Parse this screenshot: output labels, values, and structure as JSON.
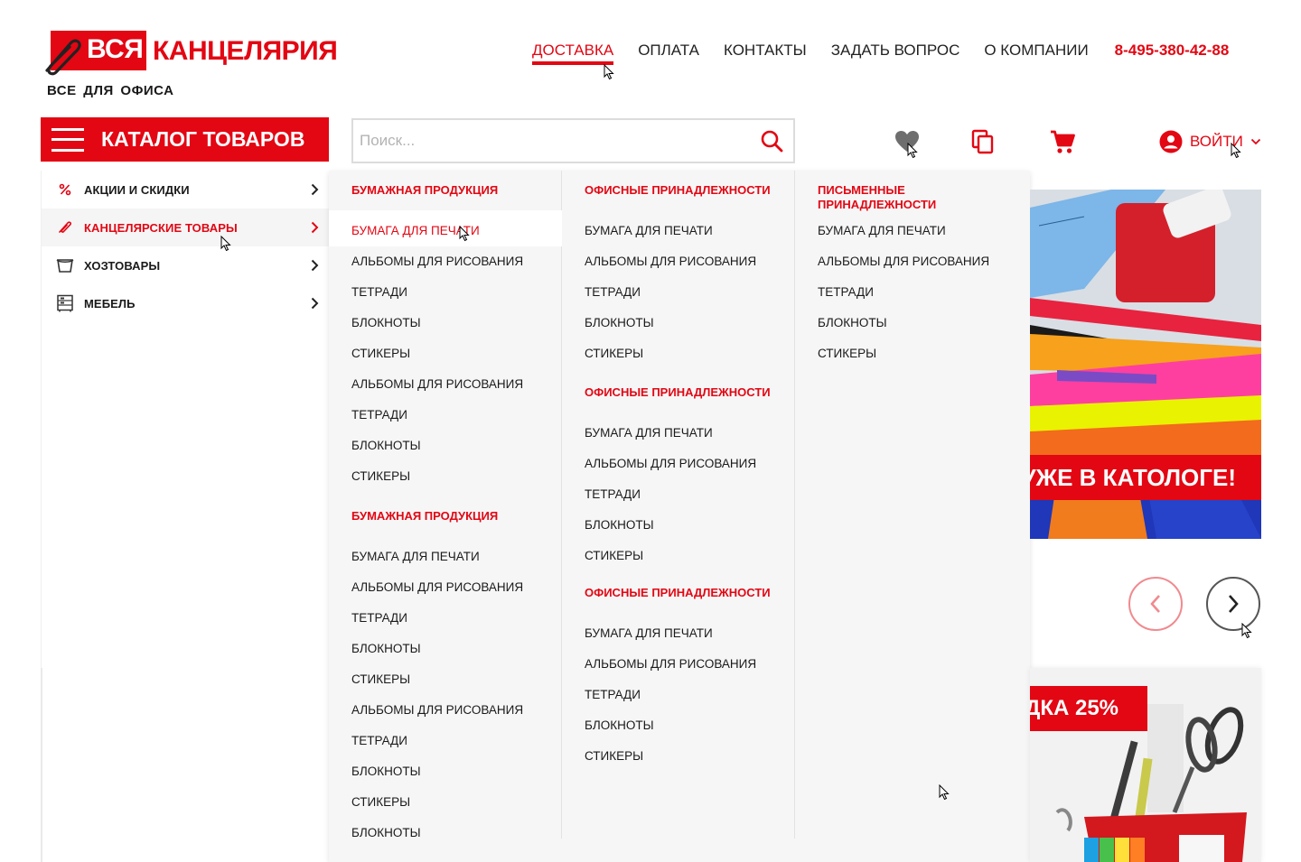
{
  "logo": {
    "badge": "ВСЯ",
    "name": "КАНЦЕЛЯРИЯ",
    "tagline": "ВСЕ ДЛЯ ОФИСА"
  },
  "topnav": {
    "items": [
      "ДОСТАВКА",
      "ОПЛАТА",
      "КОНТАКТЫ",
      "ЗАДАТЬ ВОПРОС",
      "О КОМПАНИИ"
    ],
    "active": "ДОСТАВКА",
    "phone": "8-495-380-42-88"
  },
  "catalog": {
    "label": "КАТАЛОГ ТОВАРОВ"
  },
  "search": {
    "placeholder": "Поиск...",
    "value": ""
  },
  "header_icons": [
    "heart-icon",
    "compare-icon",
    "cart-icon"
  ],
  "login": {
    "label": "ВОЙТИ"
  },
  "colors": {
    "accent": "#e30613",
    "menu_bg": "#f6f6f6",
    "text": "#1a1a1a"
  },
  "sidebar": {
    "items": [
      {
        "label": "АКЦИИ И СКИДКИ",
        "icon": "percent-icon",
        "active": false
      },
      {
        "label": "КАНЦЕЛЯРСКИЕ ТОВАРЫ",
        "icon": "paperclip-icon",
        "active": true
      },
      {
        "label": "ХОЗТОВАРЫ",
        "icon": "bucket-icon",
        "active": false
      },
      {
        "label": "МЕБЕЛЬ",
        "icon": "cabinet-icon",
        "active": false
      }
    ]
  },
  "mega": {
    "col1": {
      "head1": "БУМАЖНАЯ ПРОДУКЦИЯ",
      "links1": [
        "БУМАГА ДЛЯ ПЕЧАТИ",
        "АЛЬБОМЫ ДЛЯ РИСОВАНИЯ",
        "ТЕТРАДИ",
        "БЛОКНОТЫ",
        "СТИКЕРЫ",
        "АЛЬБОМЫ ДЛЯ РИСОВАНИЯ",
        "ТЕТРАДИ",
        "БЛОКНОТЫ",
        "СТИКЕРЫ"
      ],
      "head2": "БУМАЖНАЯ ПРОДУКЦИЯ",
      "links2": [
        "БУМАГА ДЛЯ ПЕЧАТИ",
        "АЛЬБОМЫ ДЛЯ РИСОВАНИЯ",
        "ТЕТРАДИ",
        "БЛОКНОТЫ",
        "СТИКЕРЫ",
        "АЛЬБОМЫ ДЛЯ РИСОВАНИЯ",
        "ТЕТРАДИ",
        "БЛОКНОТЫ",
        "СТИКЕРЫ",
        "БЛОКНОТЫ"
      ]
    },
    "col2": {
      "head1": "ОФИСНЫЕ ПРИНАДЛЕЖНОСТИ",
      "links1": [
        "БУМАГА ДЛЯ ПЕЧАТИ",
        "АЛЬБОМЫ ДЛЯ РИСОВАНИЯ",
        "ТЕТРАДИ",
        "БЛОКНОТЫ",
        "СТИКЕРЫ"
      ],
      "head2": "ОФИСНЫЕ ПРИНАДЛЕЖНОСТИ",
      "links2": [
        "БУМАГА ДЛЯ ПЕЧАТИ",
        "АЛЬБОМЫ ДЛЯ РИСОВАНИЯ",
        "ТЕТРАДИ",
        "БЛОКНОТЫ",
        "СТИКЕРЫ"
      ],
      "head3": "ОФИСНЫЕ ПРИНАДЛЕЖНОСТИ",
      "links3": [
        "БУМАГА ДЛЯ ПЕЧАТИ",
        "АЛЬБОМЫ ДЛЯ РИСОВАНИЯ",
        "ТЕТРАДИ",
        "БЛОКНОТЫ",
        "СТИКЕРЫ"
      ]
    },
    "col3": {
      "head1": "ПИСЬМЕННЫЕ ПРИНАДЛЕЖНОСТИ",
      "links1": [
        "БУМАГА ДЛЯ ПЕЧАТИ",
        "АЛЬБОМЫ ДЛЯ РИСОВАНИЯ",
        "ТЕТРАДИ",
        "БЛОКНОТЫ",
        "СТИКЕРЫ"
      ]
    }
  },
  "banners": {
    "main_tag": "УЖЕ В КАТОЛОГЕ!",
    "promo_tag": "ДКА 25%"
  }
}
